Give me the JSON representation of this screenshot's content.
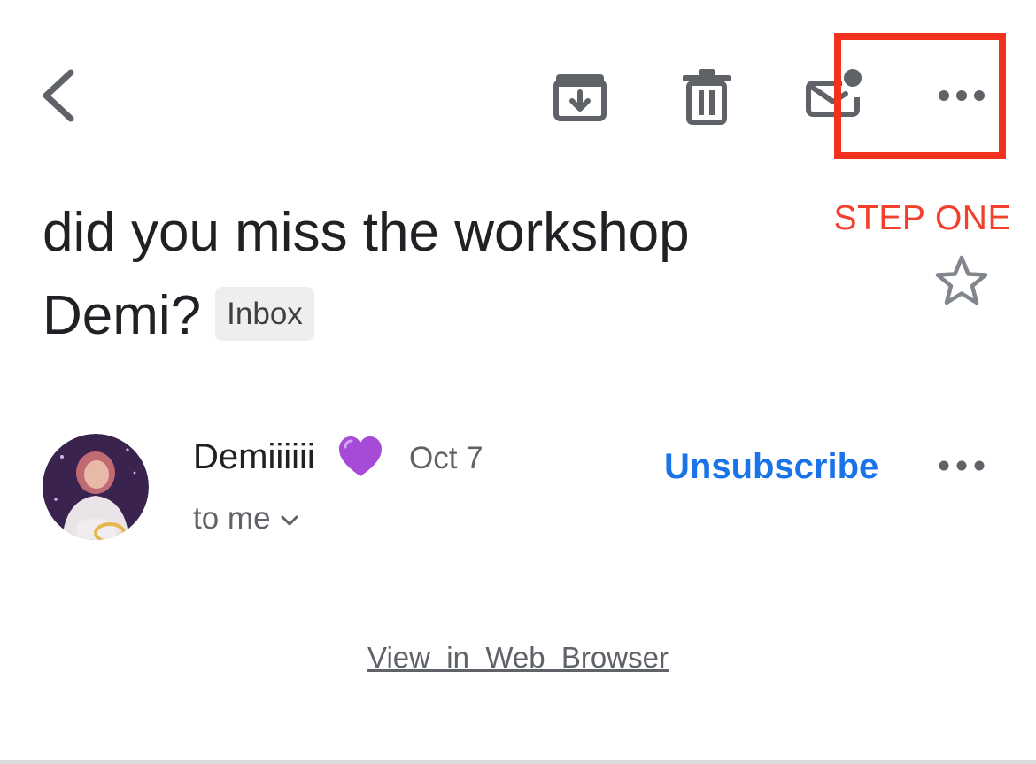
{
  "subject": {
    "text": "did you miss the workshop Demi?",
    "label_badge": "Inbox"
  },
  "annotation": {
    "label": "STEP ONE",
    "color": "#f2321c"
  },
  "toolbar": {
    "icons": [
      "back-icon",
      "archive-icon",
      "trash-icon",
      "mark-unread-icon",
      "more-options-icon"
    ]
  },
  "sender": {
    "name": "Demiiiiii",
    "emoji": "💜",
    "date": "Oct 7",
    "recipient": "to me",
    "unsubscribe_label": "Unsubscribe"
  },
  "body": {
    "web_browser_link": "View  in  Web  Browser"
  },
  "colors": {
    "icon_gray": "#5f6368",
    "link_blue": "#1a73e8",
    "annotation_red": "#f2321c",
    "heart_purple": "#a54bd8"
  }
}
